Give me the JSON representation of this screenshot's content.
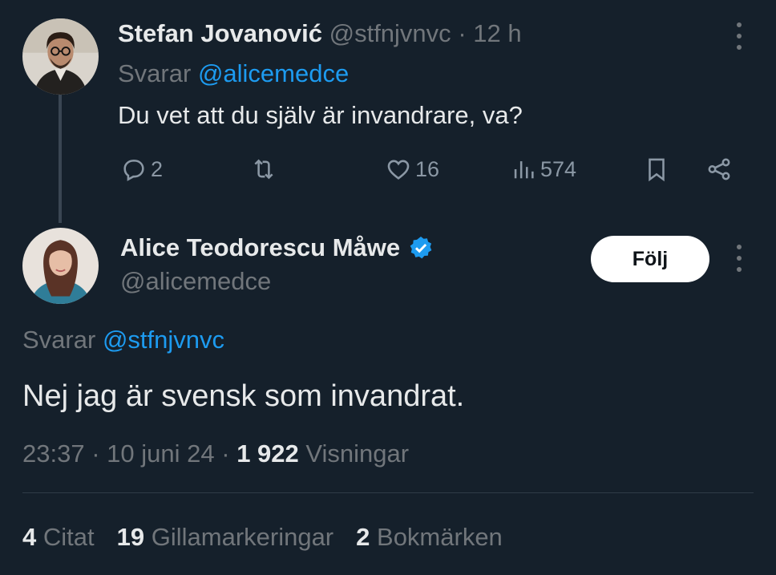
{
  "reply_tweet": {
    "author_name": "Stefan Jovanović",
    "handle": "@stfnjvnvc",
    "separator": "·",
    "time": "12 h",
    "replying_prefix": "Svarar",
    "replying_to": "@alicemedce",
    "text": "Du vet att du själv är invandrare, va?",
    "actions": {
      "replies": "2",
      "retweets": "",
      "likes": "16",
      "views": "574"
    }
  },
  "main_tweet": {
    "author_name": "Alice Teodorescu Måwe",
    "handle": "@alicemedce",
    "verified": true,
    "follow_label": "Följ",
    "replying_prefix": "Svarar",
    "replying_to": "@stfnjvnvc",
    "text": "Nej jag är svensk som invandrat.",
    "meta": {
      "time": "23:37",
      "sep1": "·",
      "date": "10 juni 24",
      "sep2": "·",
      "views_count": "1 922",
      "views_label": "Visningar"
    },
    "stats": [
      {
        "count": "4",
        "label": "Citat"
      },
      {
        "count": "19",
        "label": "Gillamarkeringar"
      },
      {
        "count": "2",
        "label": "Bokmärken"
      }
    ]
  },
  "colors": {
    "background": "#15202b",
    "accent": "#1d9bf0",
    "muted": "#71767b",
    "text": "#e7e9ea"
  },
  "icons": [
    "reply-icon",
    "retweet-icon",
    "like-icon",
    "views-icon",
    "bookmark-icon",
    "share-icon",
    "more-icon",
    "verified-badge-icon"
  ]
}
